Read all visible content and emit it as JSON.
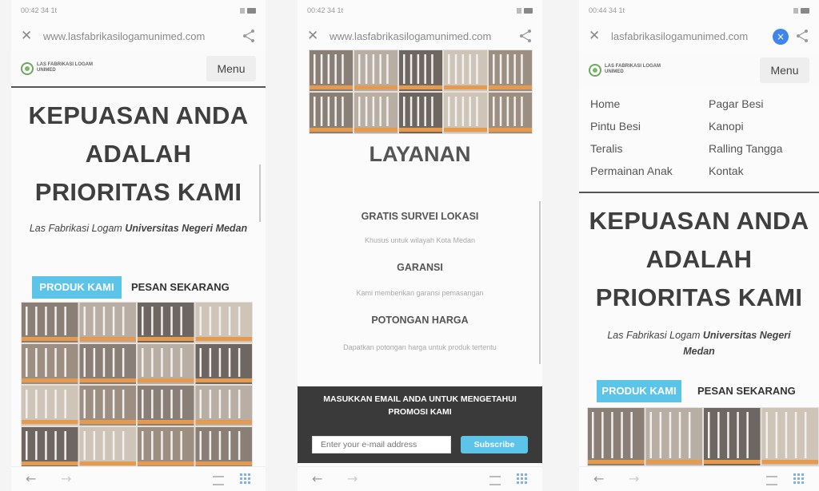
{
  "colors": {
    "accent": "#5bc4e8",
    "promo_bg": "#3a3a3a",
    "menu_bg": "#eeeeee",
    "clear_button": "#3f86e8"
  },
  "screen1": {
    "status_time": "00:42 34 1t",
    "url": "www.lasfabrikasilogamunimed.com",
    "logo_text": [
      "LAS FABRIKASI LOGAM",
      "UNIMED"
    ],
    "menu_label": "Menu",
    "hero_lines": [
      "KEPUASAN ANDA",
      "ADALAH",
      "PRIORITAS KAMI"
    ],
    "subtitle_plain": "Las Fabrikasi Logam ",
    "subtitle_bold": "Universitas Negeri Medan",
    "btn_produk": "PRODUK KAMI",
    "btn_pesan": "PESAN SEKARANG"
  },
  "screen2": {
    "status_time": "00:42 34 1t",
    "url": "www.lasfabrikasilogamunimed.com",
    "section_title": "LAYANAN",
    "services": [
      {
        "title": "GRATIS SURVEI LOKASI",
        "desc": "Khusus untuk wilayah Kota Medan"
      },
      {
        "title": "GARANSI",
        "desc": "Kami memberikan garansi pemasangan"
      },
      {
        "title": "POTONGAN HARGA",
        "desc": "Dapatkan potongan harga untuk produk tertentu"
      }
    ],
    "promo_text": "MASUKKAN EMAIL ANDA UNTUK MENGETAHUI PROMOSI KAMI",
    "email_placeholder": "Enter your e-mail address",
    "subscribe_label": "Subscribe"
  },
  "screen3": {
    "status_time": "00:44 34 1t",
    "url": "lasfabrikasilogamunimed.com",
    "clear_icon": "×",
    "logo_text": [
      "LAS FABRIKASI LOGAM",
      "UNIMED"
    ],
    "menu_label": "Menu",
    "nav_left": [
      "Home",
      "Pintu Besi",
      "Teralis",
      "Permainan Anak"
    ],
    "nav_right": [
      "Pagar Besi",
      "Kanopi",
      "Ralling Tangga",
      "Kontak"
    ],
    "hero_lines": [
      "KEPUASAN ANDA",
      "ADALAH",
      "PRIORITAS KAMI"
    ],
    "subtitle_plain": "Las Fabrikasi Logam ",
    "subtitle_bold": "Universitas Negeri Medan",
    "btn_produk": "PRODUK KAMI",
    "btn_pesan": "PESAN SEKARANG"
  },
  "icons": {
    "close": "close-icon",
    "share": "share-icon",
    "back": "back-arrow-icon",
    "forward": "forward-arrow-icon",
    "tabs": "tabs-icon",
    "apps": "apps-grid-icon"
  }
}
